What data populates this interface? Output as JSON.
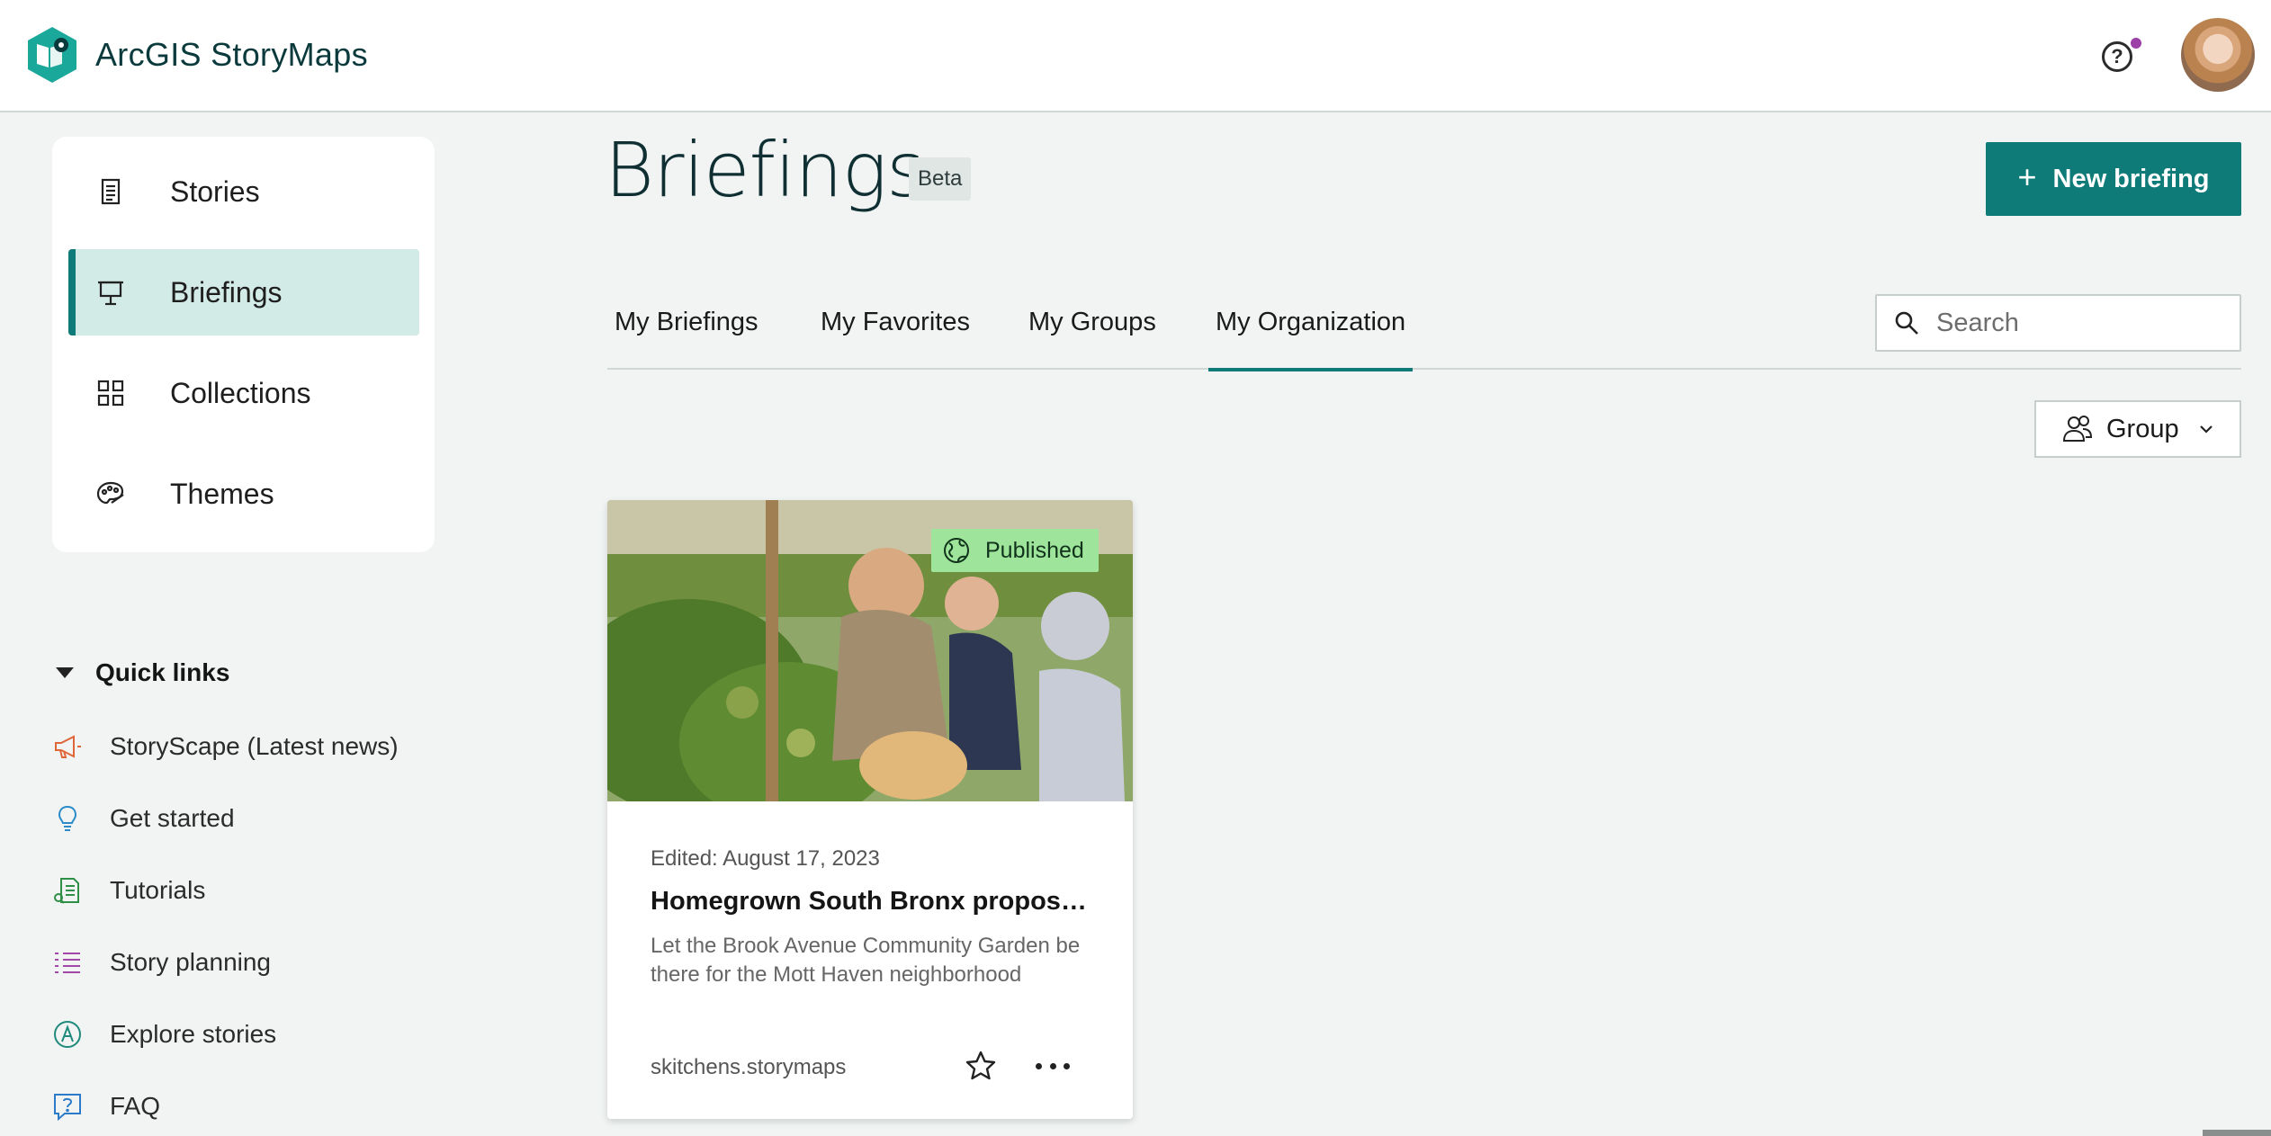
{
  "app": {
    "name": "ArcGIS StoryMaps"
  },
  "header": {
    "help_icon": "help-icon",
    "notification_color": "#9c3fa8"
  },
  "sidebar": {
    "items": [
      {
        "label": "Stories",
        "icon": "document-icon"
      },
      {
        "label": "Briefings",
        "icon": "presentation-icon",
        "active": true
      },
      {
        "label": "Collections",
        "icon": "grid-icon"
      },
      {
        "label": "Themes",
        "icon": "palette-icon"
      }
    ]
  },
  "quick_links": {
    "title": "Quick links",
    "items": [
      {
        "label": "StoryScape (Latest news)",
        "icon": "megaphone-icon"
      },
      {
        "label": "Get started",
        "icon": "lightbulb-icon"
      },
      {
        "label": "Tutorials",
        "icon": "tutorial-icon"
      },
      {
        "label": "Story planning",
        "icon": "list-icon"
      },
      {
        "label": "Explore stories",
        "icon": "explore-icon"
      },
      {
        "label": "FAQ",
        "icon": "faq-icon"
      }
    ]
  },
  "main": {
    "title": "Briefings",
    "badge": "Beta",
    "new_button": {
      "plus": "+",
      "label": "New briefing"
    },
    "tabs": [
      {
        "label": "My Briefings"
      },
      {
        "label": "My Favorites"
      },
      {
        "label": "My Groups"
      },
      {
        "label": "My Organization",
        "active": true
      }
    ],
    "search": {
      "placeholder": "Search"
    },
    "filter": {
      "label": "Group"
    }
  },
  "cards": [
    {
      "status": "Published",
      "edited": "Edited: August 17, 2023",
      "title": "Homegrown South Bronx propos…",
      "description": "Let the Brook Avenue Community Garden be there for the Mott Haven neighborhood",
      "owner": "skitchens.storymaps"
    }
  ],
  "colors": {
    "accent": "#0f7b79",
    "active_bg": "#d3ebe6",
    "published_bg": "#9ee59b"
  }
}
